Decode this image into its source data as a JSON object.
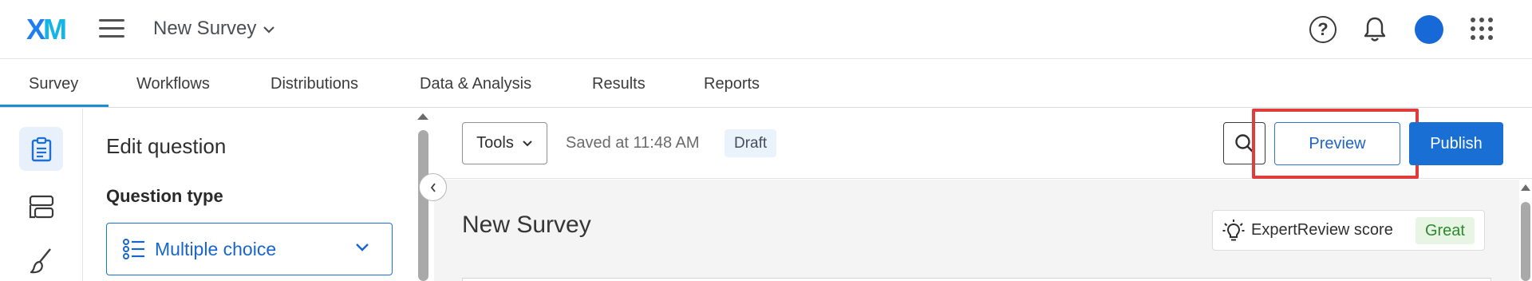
{
  "header": {
    "logo": {
      "x": "X",
      "m": "M"
    },
    "survey_title": "New Survey",
    "icons": [
      "menu-icon",
      "help-icon",
      "bell-icon",
      "avatar",
      "apps-grid-icon"
    ]
  },
  "tabs": [
    {
      "label": "Survey",
      "active": true
    },
    {
      "label": "Workflows"
    },
    {
      "label": "Distributions"
    },
    {
      "label": "Data & Analysis"
    },
    {
      "label": "Results"
    },
    {
      "label": "Reports"
    }
  ],
  "rail": {
    "items": [
      "survey-clipboard-icon",
      "blocks-layout-icon",
      "brush-icon"
    ]
  },
  "panel": {
    "heading": "Edit question",
    "question_type_label": "Question type",
    "question_type_value": "Multiple choice"
  },
  "toolbar": {
    "tools_label": "Tools",
    "saved_text": "Saved at 11:48 AM",
    "status_badge": "Draft",
    "preview_label": "Preview",
    "publish_label": "Publish"
  },
  "canvas": {
    "title": "New Survey",
    "expert_review_label": "ExpertReview score",
    "expert_review_score": "Great"
  },
  "colors": {
    "accent": "#1a6fd4",
    "highlight": "#e03c3c",
    "great": "#2b8a2b"
  }
}
